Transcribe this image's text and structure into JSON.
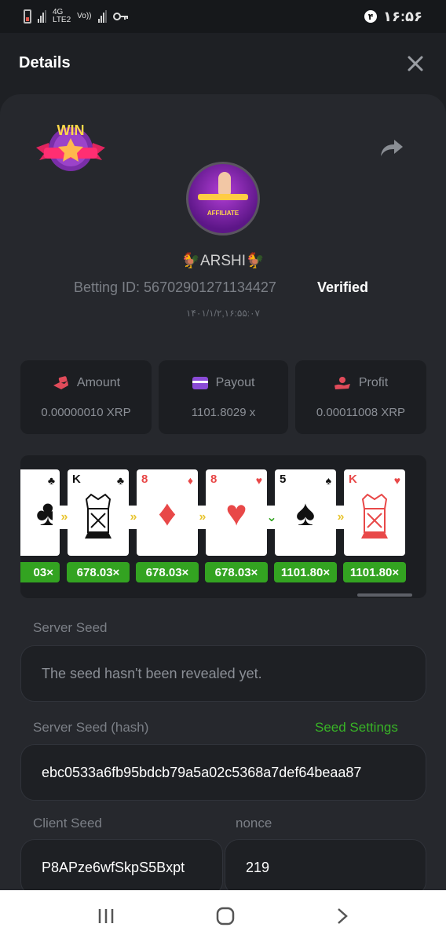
{
  "status_bar": {
    "network": "4G\nLTE2",
    "volte": "Vo))",
    "time": "۱۶:۵۶",
    "notif_count": "۴"
  },
  "header": {
    "title": "Details"
  },
  "profile": {
    "name": "🐓ARSHI🐓",
    "betting_label": "Betting ID: 56702901271134427",
    "verified": "Verified",
    "date": "۱۴۰۱/۱/۲,۱۶:۵۵:۰۷",
    "avatar_text": "AFFILIATE",
    "badge_text": "WIN"
  },
  "stats": [
    {
      "label": "Amount",
      "value": "0.00000010 XRP",
      "icon": "money-hand-icon",
      "color": "#e14b5a"
    },
    {
      "label": "Payout",
      "value": "1101.8029 x",
      "icon": "wallet-icon",
      "color": "#8a4bd6"
    },
    {
      "label": "Profit",
      "value": "0.00011008 XRP",
      "icon": "profit-hand-icon",
      "color": "#e14b5a"
    }
  ],
  "cards": [
    {
      "rank": "",
      "suit": "♣",
      "color": "#111"
    },
    {
      "rank": "K",
      "suit": "♣",
      "color": "#111"
    },
    {
      "rank": "8",
      "suit": "♦",
      "color": "#e84848"
    },
    {
      "rank": "8",
      "suit": "♥",
      "color": "#e84848"
    },
    {
      "rank": "5",
      "suit": "♠",
      "color": "#111"
    },
    {
      "rank": "K",
      "suit": "♥",
      "color": "#e84848"
    }
  ],
  "arrows": [
    "»",
    "»",
    "»",
    "⌄",
    "»"
  ],
  "multipliers": [
    "03×",
    "678.03×",
    "678.03×",
    "678.03×",
    "1101.80×",
    "1101.80×"
  ],
  "seeds": {
    "server_seed_label": "Server Seed",
    "server_seed_value": "The seed hasn't been revealed yet.",
    "server_hash_label": "Server Seed (hash)",
    "seed_settings": "Seed Settings",
    "server_hash_value": "ebc0533a6fb95bdcb79a5a02c5368a7def64beaa87",
    "client_seed_label": "Client Seed",
    "client_seed_value": "P8APze6wfSkpS5Bxpt",
    "nonce_label": "nonce",
    "nonce_value": "219"
  }
}
